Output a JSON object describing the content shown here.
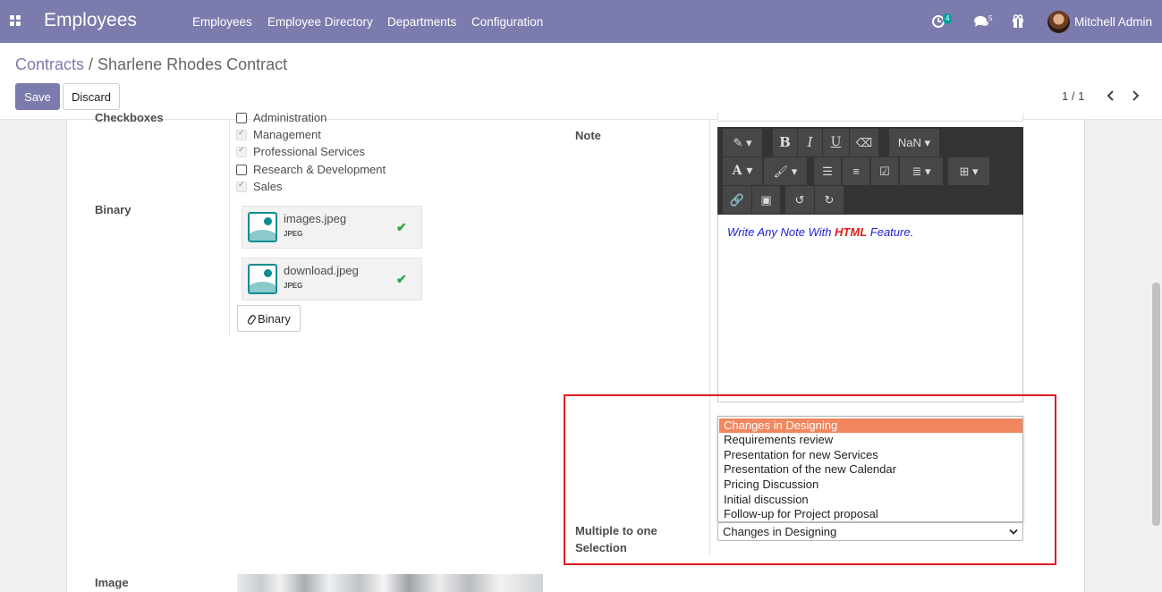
{
  "navbar": {
    "app_title": "Employees",
    "menu": [
      "Employees",
      "Employee Directory",
      "Departments",
      "Configuration"
    ],
    "activity_count": "4",
    "message_count": "5",
    "user_name": "Mitchell Admin",
    "color": "#7c7bad"
  },
  "breadcrumb": {
    "parent": "Contracts",
    "separator": "/",
    "current": "Sharlene Rhodes Contract"
  },
  "buttons": {
    "save": "Save",
    "discard": "Discard"
  },
  "pager": {
    "value": "1 / 1"
  },
  "form": {
    "checkboxes_label": "Checkboxes",
    "checkboxes": [
      {
        "label": "Administration",
        "checked": false
      },
      {
        "label": "Management",
        "checked": true
      },
      {
        "label": "Professional Services",
        "checked": true
      },
      {
        "label": "Research & Development",
        "checked": false
      },
      {
        "label": "Sales",
        "checked": true
      }
    ],
    "binary_label": "Binary",
    "attachments": [
      {
        "name": "images.jpeg",
        "type": "JPEG"
      },
      {
        "name": "download.jpeg",
        "type": "JPEG"
      }
    ],
    "binary_button": "Binary",
    "note_label": "Note",
    "toolbar": {
      "font_size": "NaN"
    },
    "note": {
      "before": "Write Any Note With ",
      "emphasis": "HTML",
      "after": " Feature."
    },
    "selection_label_line1": "Multiple to one",
    "selection_label_line2": "Selection",
    "selection_options": [
      "Changes in Designing",
      "Requirements review",
      "Presentation for new Services",
      "Presentation of the new Calendar",
      "Pricing Discussion",
      "Initial discussion",
      "Follow-up for Project proposal"
    ],
    "selection_value": "Changes in Designing",
    "image_label": "Image"
  },
  "colors": {
    "primary": "#7c7bad",
    "highlight_option": "#f2865e",
    "annotation_border": "#e01b24",
    "success": "#28a745",
    "note_text": "#1f1fe0",
    "note_emphasis": "#e01a1a"
  }
}
